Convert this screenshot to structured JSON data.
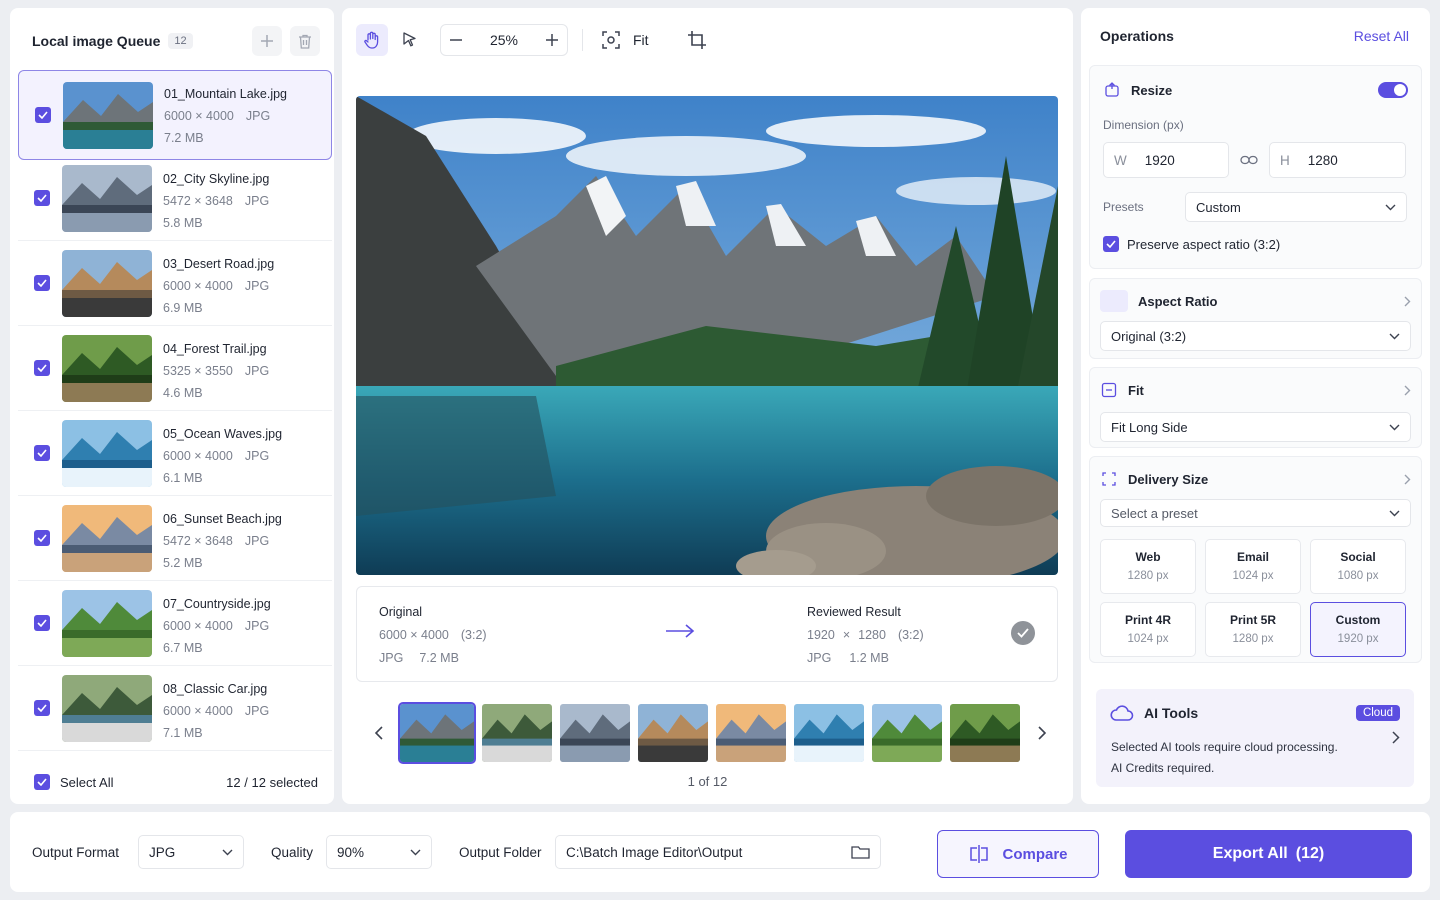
{
  "queue": {
    "title": "Local image Queue",
    "count": "12",
    "items": [
      {
        "name": "01_Mountain Lake.jpg",
        "dims": "6000 × 4000",
        "format": "JPG",
        "size": "7.2 MB",
        "thumb": "mountain-lake"
      },
      {
        "name": "02_City Skyline.jpg",
        "dims": "5472 × 3648",
        "format": "JPG",
        "size": "5.8 MB",
        "thumb": "city-skyline"
      },
      {
        "name": "03_Desert Road.jpg",
        "dims": "6000 × 4000",
        "format": "JPG",
        "size": "6.9 MB",
        "thumb": "desert-road"
      },
      {
        "name": "04_Forest Trail.jpg",
        "dims": "5325 × 3550",
        "format": "JPG",
        "size": "4.6 MB",
        "thumb": "forest-trail"
      },
      {
        "name": "05_Ocean Waves.jpg",
        "dims": "6000 × 4000",
        "format": "JPG",
        "size": "6.1 MB",
        "thumb": "ocean-waves"
      },
      {
        "name": "06_Sunset Beach.jpg",
        "dims": "5472 × 3648",
        "format": "JPG",
        "size": "5.2 MB",
        "thumb": "sunset-beach"
      },
      {
        "name": "07_Countryside.jpg",
        "dims": "6000 × 4000",
        "format": "JPG",
        "size": "6.7 MB",
        "thumb": "countryside"
      },
      {
        "name": "08_Classic Car.jpg",
        "dims": "6000 × 4000",
        "format": "JPG",
        "size": "7.1 MB",
        "thumb": "classic-car"
      }
    ],
    "select_all": "Select All",
    "selected_count": "12",
    "selected_sep": " / ",
    "selected_total": "12",
    "selected_suffix": " selected"
  },
  "toolbar": {
    "zoom": "25%",
    "fit_label": "Fit"
  },
  "compare": {
    "original_title": "Original",
    "original_dims": "6000 × 4000",
    "original_ratio": "(3:2)",
    "original_format": "JPG",
    "original_size": "7.2 MB",
    "result_title": "Reviewed Result",
    "result_w": "1920",
    "result_x": "×",
    "result_h": "1280",
    "result_ratio": "(3:2)",
    "result_format": "JPG",
    "result_size": "1.2 MB"
  },
  "pager": "1 of 12",
  "ops": {
    "title": "Operations",
    "reset": "Reset All",
    "resize": {
      "title": "Resize",
      "enabled": true,
      "dimension_label": "Dimension (px)",
      "w_prefix": "W",
      "w_value": "1920",
      "h_prefix": "H",
      "h_value": "1280",
      "presets_label": "Presets",
      "presets_value": "Custom",
      "preserve_label": "Preserve aspect ratio (3:2)"
    },
    "aspect": {
      "title": "Aspect Ratio",
      "value": "Original (3:2)"
    },
    "fit": {
      "title": "Fit",
      "value": "Fit Long Side"
    },
    "delivery": {
      "title": "Delivery Size",
      "placeholder": "Select a preset",
      "presets": [
        {
          "name": "Web",
          "size": "1280 px"
        },
        {
          "name": "Email",
          "size": "1024 px"
        },
        {
          "name": "Social",
          "size": "1080 px"
        },
        {
          "name": "Print 4R",
          "size": "1024 px"
        },
        {
          "name": "Print 5R",
          "size": "1280 px"
        },
        {
          "name": "Custom",
          "size": "1920 px"
        }
      ]
    },
    "ai": {
      "title": "AI Tools",
      "badge": "Cloud",
      "line1": "Selected AI tools require cloud processing.",
      "line2": "AI Credits required."
    }
  },
  "bottom": {
    "format_label": "Output Format",
    "format_value": "JPG",
    "quality_label": "Quality",
    "quality_value": "90%",
    "folder_label": "Output Folder",
    "folder_value": "C:\\Batch Image Editor\\Output",
    "compare_label": "Compare",
    "export_label": "Export All",
    "export_count": "(12)"
  },
  "colors": {
    "accent": "#5b4ee0",
    "background": "#eceef2"
  }
}
